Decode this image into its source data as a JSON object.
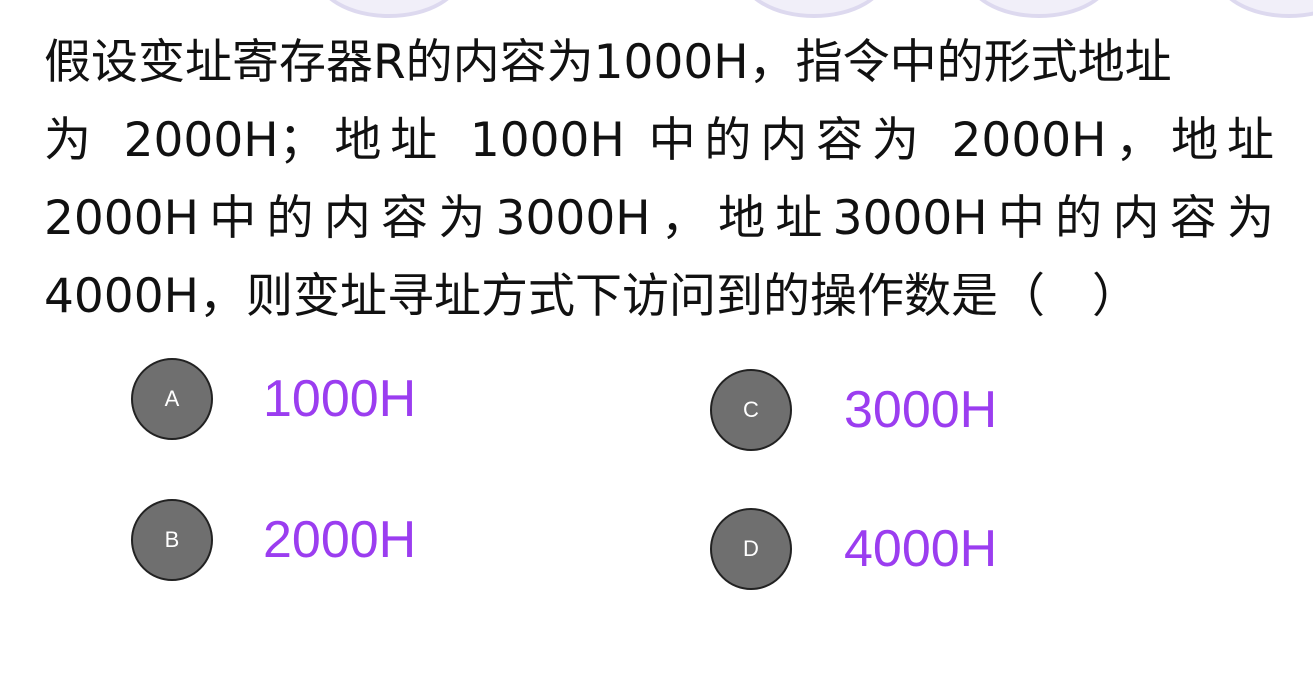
{
  "question": {
    "lines": [
      "假设变址寄存器R的内容为1000H，指令中的形式地址",
      "为 2000H；地址 1000H 中的内容为 2000H，地址",
      "2000H中的内容为3000H，地址3000H中的内容为",
      "4000H，则变址寻址方式下访问到的操作数是（　）"
    ]
  },
  "options": [
    {
      "letter": "A",
      "value": "1000H"
    },
    {
      "letter": "B",
      "value": "2000H"
    },
    {
      "letter": "C",
      "value": "3000H"
    },
    {
      "letter": "D",
      "value": "4000H"
    }
  ],
  "colors": {
    "option_text": "#9b3df0",
    "option_circle": "#6f6f6f",
    "question_text": "#111111"
  }
}
